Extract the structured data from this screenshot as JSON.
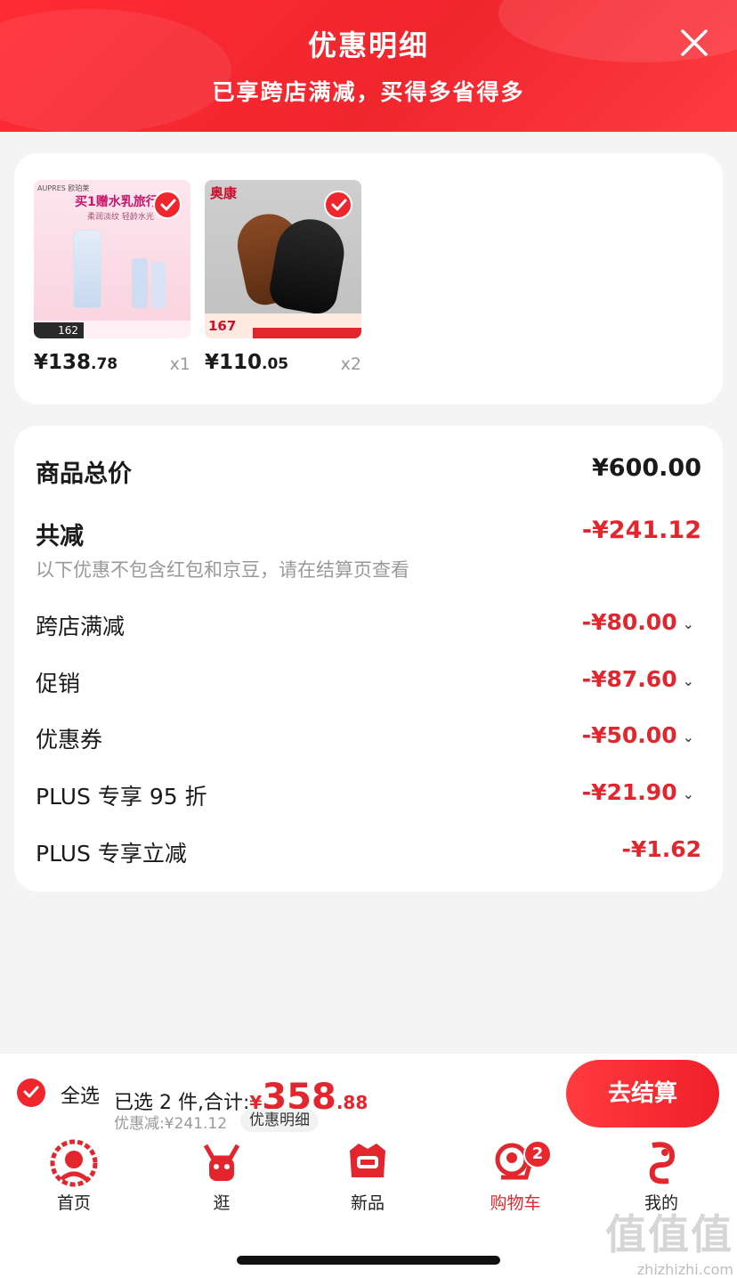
{
  "header": {
    "title": "优惠明细",
    "subtitle": "已享跨店满减，买得多省得多"
  },
  "products": [
    {
      "brand": "AUPRES 欧珀莱",
      "promo": "买1赠水乳旅行装",
      "promo_sub": "柔润淡纹 轻龄水光",
      "badge_price": "162",
      "price_int": "¥138",
      "price_dec": ".78",
      "qty": "x1",
      "selected": true
    },
    {
      "brand": "奥康",
      "badge_price": "167",
      "price_int": "¥110",
      "price_dec": ".05",
      "qty": "x2",
      "selected": true
    }
  ],
  "details": {
    "total_label": "商品总价",
    "total_value": "¥600.00",
    "reduce_label": "共减",
    "reduce_value": "-¥241.12",
    "note": "以下优惠不包含红包和京豆，请在结算页查看",
    "items": [
      {
        "label": "跨店满减",
        "value": "-¥80.00",
        "expandable": true
      },
      {
        "label": "促销",
        "value": "-¥87.60",
        "expandable": true
      },
      {
        "label": "优惠券",
        "value": "-¥50.00",
        "expandable": true
      },
      {
        "label": "PLUS 专享 95 折",
        "value": "-¥21.90",
        "expandable": true
      },
      {
        "label": "PLUS 专享立减",
        "value": "-¥1.62",
        "expandable": false
      }
    ]
  },
  "checkout": {
    "select_all": "全选",
    "selected_text": "已选 2 件,合计:",
    "yen": "¥",
    "total_int": "358",
    "total_dec": ".88",
    "saved": "优惠减:¥241.12",
    "detail_link": "优惠明细",
    "pay_button": "去结算"
  },
  "tabs": [
    {
      "label": "首页",
      "icon": "home-papercut-icon"
    },
    {
      "label": "逛",
      "icon": "browse-papercut-icon"
    },
    {
      "label": "新品",
      "icon": "new-papercut-icon"
    },
    {
      "label": "购物车",
      "icon": "cart-papercut-icon",
      "badge": "2",
      "active": true
    },
    {
      "label": "我的",
      "icon": "profile-papercut-icon"
    }
  ],
  "watermark": {
    "logo": "值值值",
    "url": "zhizhizhi.com"
  },
  "colors": {
    "accent": "#e3262d",
    "header": "#f0262d"
  }
}
